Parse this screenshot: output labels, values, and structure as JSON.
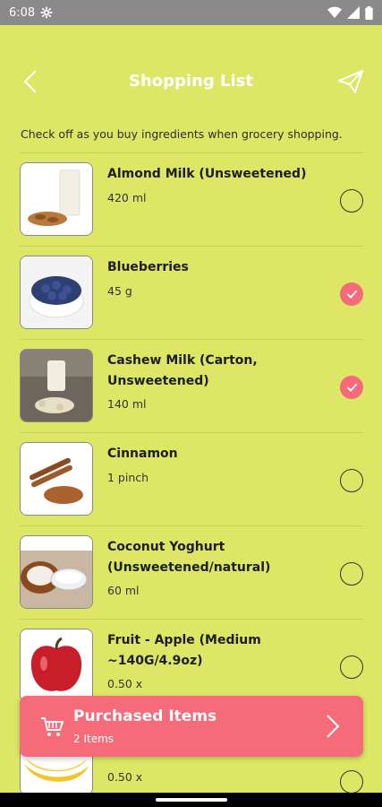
{
  "status": {
    "time": "6:08"
  },
  "header": {
    "title": "Shopping List"
  },
  "subtitle": "Check off as you buy ingredients when grocery shopping.",
  "items": [
    {
      "name": "Almond Milk (Unsweetened)",
      "qty": "420 ml",
      "checked": false
    },
    {
      "name": "Blueberries",
      "qty": "45 g",
      "checked": true
    },
    {
      "name": "Cashew Milk (Carton, Unsweetened)",
      "qty": "140 ml",
      "checked": true
    },
    {
      "name": "Cinnamon",
      "qty": "1 pinch",
      "checked": false
    },
    {
      "name": "Coconut Yoghurt (Unsweetened/natural)",
      "qty": "60 ml",
      "checked": false
    },
    {
      "name": "Fruit - Apple (Medium ~140G/4.9oz)",
      "qty": "0.50 x",
      "checked": false
    },
    {
      "name": "",
      "qty": "0.50 x",
      "checked": false
    }
  ],
  "purchased": {
    "title": "Purchased Items",
    "count": "2 Items"
  },
  "colors": {
    "background": "#dde765",
    "accent": "#f56b7a"
  }
}
